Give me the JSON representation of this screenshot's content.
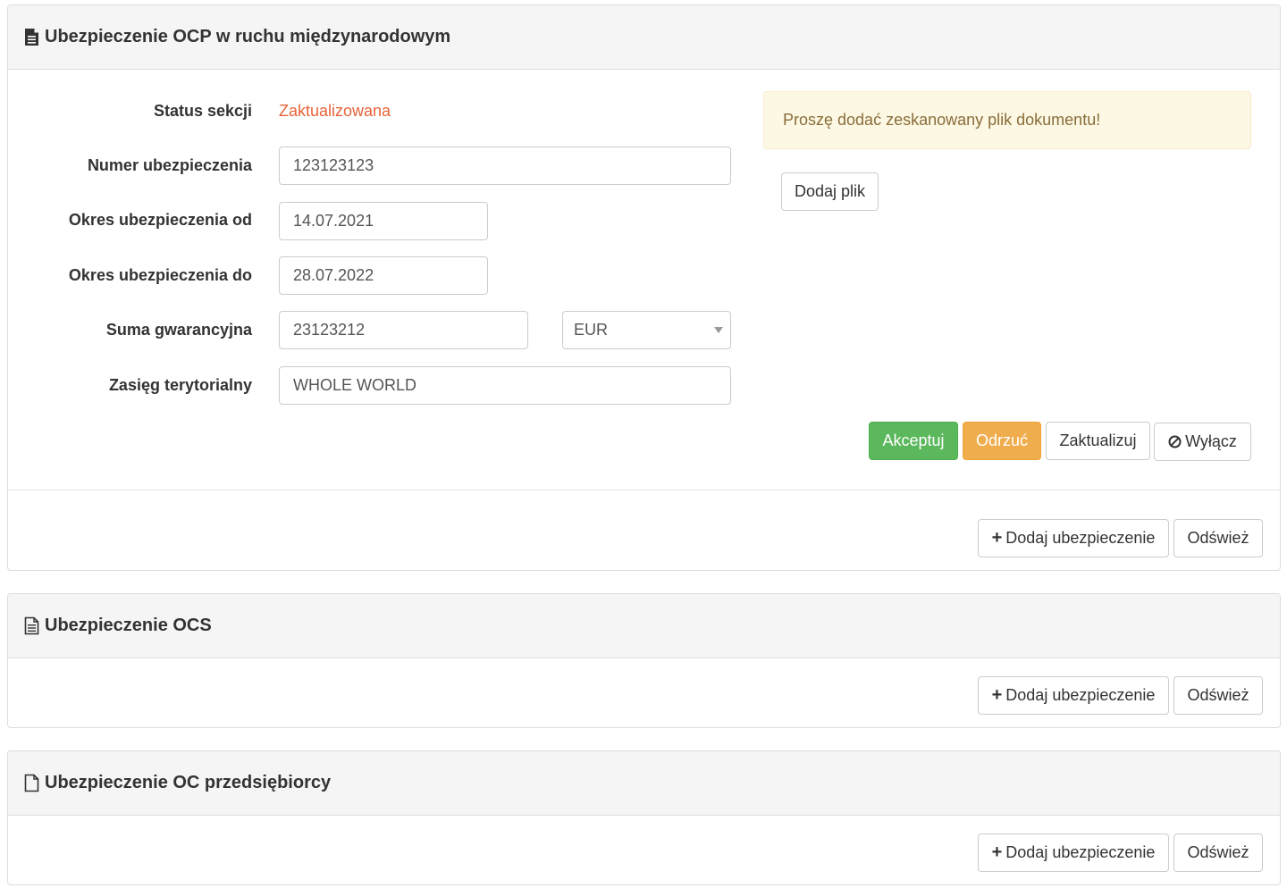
{
  "section1": {
    "title": "Ubezpieczenie OCP w ruchu międzynarodowym",
    "status_label": "Status sekcji",
    "status_value": "Zaktualizowana",
    "number_label": "Numer ubezpieczenia",
    "number_value": "123123123",
    "from_label": "Okres ubezpieczenia od",
    "from_value": "14.07.2021",
    "to_label": "Okres ubezpieczenia do",
    "to_value": "28.07.2022",
    "sum_label": "Suma gwarancyjna",
    "sum_value": "23123212",
    "currency_value": "EUR",
    "range_label": "Zasięg terytorialny",
    "range_value": "WHOLE WORLD",
    "alert_text": "Proszę dodać zeskanowany plik dokumentu!",
    "add_file_label": "Dodaj plik",
    "accept_label": "Akceptuj",
    "reject_label": "Odrzuć",
    "update_label": "Zaktualizuj",
    "disable_label": "Wyłącz",
    "add_insurance_label": "Dodaj ubezpieczenie",
    "refresh_label": "Odśwież"
  },
  "section2": {
    "title": "Ubezpieczenie OCS",
    "add_insurance_label": "Dodaj ubezpieczenie",
    "refresh_label": "Odśwież"
  },
  "section3": {
    "title": "Ubezpieczenie OC przedsiębiorcy",
    "add_insurance_label": "Dodaj ubezpieczenie",
    "refresh_label": "Odśwież"
  },
  "icons": {
    "section1": "file-filled-icon",
    "section2": "file-text-outline-icon",
    "section3": "file-outline-icon",
    "plus": "plus-icon",
    "ban": "ban-icon"
  },
  "colors": {
    "status": "#e8633a",
    "success": "#5cb85c",
    "warning": "#f0ad4e",
    "alert_bg": "#fcf8e3",
    "alert_text": "#8a6d3b"
  }
}
